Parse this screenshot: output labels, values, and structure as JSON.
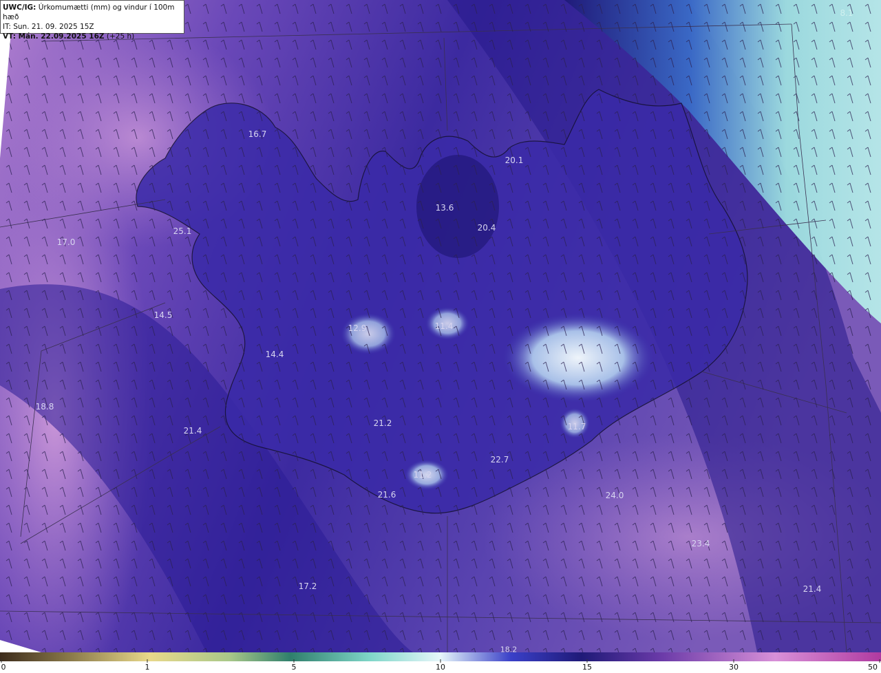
{
  "header": {
    "model": "UWC/IG:",
    "title": "Úrkomumætti (mm) og vindur í 100m hæð",
    "it_line": "IT: Sun. 21. 09. 2025 15Z",
    "vt_prefix": "VT: ",
    "vt_bold": "Mán. 22.09.2025 16Z",
    "vt_lead": " (+25 h)"
  },
  "field_labels": [
    {
      "text": "16.7",
      "name": "label-16-7-nw"
    },
    {
      "text": "20.1",
      "name": "label-20-1"
    },
    {
      "text": "13.6",
      "name": "label-13-6"
    },
    {
      "text": "20.4",
      "name": "label-20-4"
    },
    {
      "text": "25.1",
      "name": "label-25-1"
    },
    {
      "text": "17.0",
      "name": "label-17-0"
    },
    {
      "text": "14.5",
      "name": "label-14-5"
    },
    {
      "text": "12.9",
      "name": "label-12-9"
    },
    {
      "text": "11.4",
      "name": "label-11-4"
    },
    {
      "text": "14.4",
      "name": "label-14-4"
    },
    {
      "text": "18.8",
      "name": "label-18-8"
    },
    {
      "text": "21.4",
      "name": "label-21-4-w"
    },
    {
      "text": "21.2",
      "name": "label-21-2"
    },
    {
      "text": "11.7",
      "name": "label-11-7"
    },
    {
      "text": "22.7",
      "name": "label-22-7"
    },
    {
      "text": "11.2",
      "name": "label-11-2"
    },
    {
      "text": "21.6",
      "name": "label-21-6"
    },
    {
      "text": "24.0",
      "name": "label-24-0"
    },
    {
      "text": "23.4",
      "name": "label-23-4"
    },
    {
      "text": "17.2",
      "name": "label-17-2"
    },
    {
      "text": "21.4",
      "name": "label-21-4-se"
    },
    {
      "text": "18.2",
      "name": "label-18-2"
    },
    {
      "text": "8.1",
      "name": "label-8-1"
    }
  ],
  "colorbar": {
    "ticks": [
      "0",
      "1",
      "5",
      "10",
      "15",
      "30",
      "50"
    ],
    "colors": [
      "#3d2c1c",
      "#8a7a4a",
      "#e8d88a",
      "#a9c889",
      "#2f7f6c",
      "#7fd6c8",
      "#e6f6fa",
      "#3a40c8",
      "#1f1a78",
      "#6a3aa8",
      "#d890d8",
      "#b03aa0"
    ]
  },
  "legend_colors": {
    "deep": "#2a1f8c",
    "mid": "#4a3aa8",
    "light_violet": "#9a72c8",
    "pink": "#cf9ad8",
    "teal": "#8fd8d8",
    "snow": "#e4eef8"
  }
}
